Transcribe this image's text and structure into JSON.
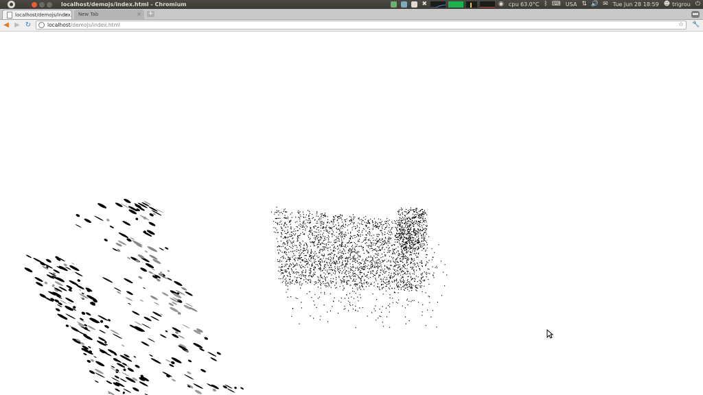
{
  "top_panel": {
    "window_title": "localhost/demojs/index.html - Chromium",
    "cpu": "cpu 63.0°C",
    "keyboard": "USA",
    "datetime": "Tue Jun 28 18:59",
    "user": "trigrou",
    "icons": [
      "ubuntu-logo-icon",
      "close-icon",
      "minimize-icon",
      "maximize-icon",
      "network-icon",
      "battery-icon",
      "checkbox-icon",
      "dropbox-icon",
      "system-monitor-icon",
      "bluetooth-icon",
      "keyboard-icon",
      "sync-icon",
      "volume-icon",
      "mail-icon",
      "user-icon",
      "power-icon"
    ]
  },
  "tabs": [
    {
      "label": "localhost/demojs/index.h",
      "active": true
    },
    {
      "label": "New Tab",
      "active": false
    }
  ],
  "toolbar": {
    "url_host": "localhost",
    "url_path": "/demojs/index.html"
  },
  "colors": {
    "close": "#e85c2e",
    "panel": "#3c3b37",
    "accent_green": "#19b24b"
  }
}
